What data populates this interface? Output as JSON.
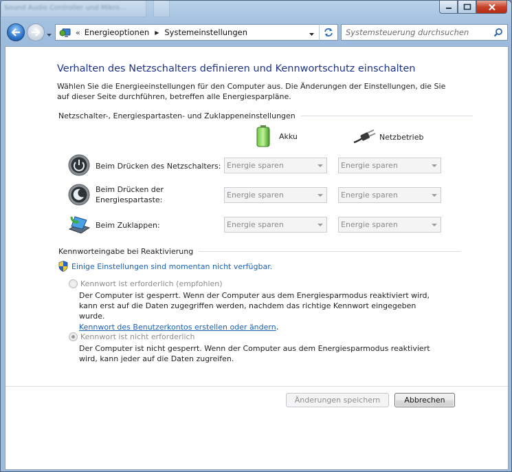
{
  "window": {
    "background_tabs": [
      "Sound Audio Controller und Mikro...",
      ""
    ],
    "buttons": {
      "minimize": "minimize",
      "maximize": "maximize",
      "close": "close"
    }
  },
  "nav": {
    "back_icon": "back-arrow-icon",
    "forward_icon": "forward-arrow-icon",
    "breadcrumb_prefix": "«",
    "breadcrumbs": [
      "Energieoptionen",
      "Systemeinstellungen"
    ],
    "search_placeholder": "Systemsteuerung durchsuchen"
  },
  "page": {
    "title": "Verhalten des Netzschalters definieren und Kennwortschutz einschalten",
    "intro": "Wählen Sie die Energieeinstellungen für den Computer aus. Die Änderungen der Einstellungen, die Sie auf dieser Seite durchführen, betreffen alle Energiesparpläne.",
    "section_power": "Netzschalter-, Energiespartasten- und Zuklappeneinstellungen",
    "col_battery": "Akku",
    "col_ac": "Netzbetrieb",
    "rows": [
      {
        "label": "Beim Drücken des Netzschalters:",
        "battery": "Energie sparen",
        "ac": "Energie sparen",
        "icon": "power-button-icon"
      },
      {
        "label": "Beim Drücken der Energiespartaste:",
        "label_line1": "Beim Drücken der",
        "label_line2": "Energiespartaste:",
        "battery": "Energie sparen",
        "ac": "Energie sparen",
        "icon": "sleep-button-icon"
      },
      {
        "label": "Beim Zuklappen:",
        "battery": "Energie sparen",
        "ac": "Energie sparen",
        "icon": "laptop-lid-icon"
      }
    ],
    "section_password": "Kennworteingabe bei Reaktivierung",
    "unavailable_link": "Einige Einstellungen sind momentan nicht verfügbar.",
    "option_required": {
      "label": "Kennwort ist erforderlich (empfohlen)",
      "desc": "Der Computer ist gesperrt. Wenn der Computer aus dem Energiesparmodus reaktiviert wird, kann erst auf die Daten zugegriffen werden, nachdem das richtige Kennwort eingegeben wurde.",
      "link": "Kennwort des Benutzerkontos erstellen oder ändern",
      "link_suffix": ".",
      "selected": false
    },
    "option_not_required": {
      "label": "Kennwort ist nicht erforderlich",
      "desc": "Der Computer ist nicht gesperrt. Wenn der Computer aus dem Energiesparmodus reaktiviert wird, kann jeder auf die Daten zugreifen.",
      "selected": true
    },
    "save_button": "Änderungen speichern",
    "cancel_button": "Abbrechen"
  },
  "colors": {
    "link": "#1a5fb4",
    "title": "#1e3287"
  }
}
